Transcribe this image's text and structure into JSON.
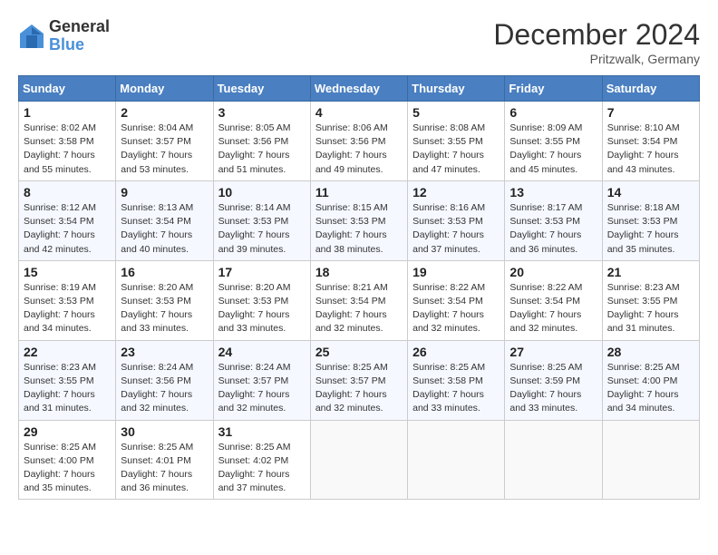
{
  "header": {
    "logo_general": "General",
    "logo_blue": "Blue",
    "month_title": "December 2024",
    "subtitle": "Pritzwalk, Germany"
  },
  "weekdays": [
    "Sunday",
    "Monday",
    "Tuesday",
    "Wednesday",
    "Thursday",
    "Friday",
    "Saturday"
  ],
  "weeks": [
    [
      {
        "day": "1",
        "sunrise": "Sunrise: 8:02 AM",
        "sunset": "Sunset: 3:58 PM",
        "daylight": "Daylight: 7 hours and 55 minutes."
      },
      {
        "day": "2",
        "sunrise": "Sunrise: 8:04 AM",
        "sunset": "Sunset: 3:57 PM",
        "daylight": "Daylight: 7 hours and 53 minutes."
      },
      {
        "day": "3",
        "sunrise": "Sunrise: 8:05 AM",
        "sunset": "Sunset: 3:56 PM",
        "daylight": "Daylight: 7 hours and 51 minutes."
      },
      {
        "day": "4",
        "sunrise": "Sunrise: 8:06 AM",
        "sunset": "Sunset: 3:56 PM",
        "daylight": "Daylight: 7 hours and 49 minutes."
      },
      {
        "day": "5",
        "sunrise": "Sunrise: 8:08 AM",
        "sunset": "Sunset: 3:55 PM",
        "daylight": "Daylight: 7 hours and 47 minutes."
      },
      {
        "day": "6",
        "sunrise": "Sunrise: 8:09 AM",
        "sunset": "Sunset: 3:55 PM",
        "daylight": "Daylight: 7 hours and 45 minutes."
      },
      {
        "day": "7",
        "sunrise": "Sunrise: 8:10 AM",
        "sunset": "Sunset: 3:54 PM",
        "daylight": "Daylight: 7 hours and 43 minutes."
      }
    ],
    [
      {
        "day": "8",
        "sunrise": "Sunrise: 8:12 AM",
        "sunset": "Sunset: 3:54 PM",
        "daylight": "Daylight: 7 hours and 42 minutes."
      },
      {
        "day": "9",
        "sunrise": "Sunrise: 8:13 AM",
        "sunset": "Sunset: 3:54 PM",
        "daylight": "Daylight: 7 hours and 40 minutes."
      },
      {
        "day": "10",
        "sunrise": "Sunrise: 8:14 AM",
        "sunset": "Sunset: 3:53 PM",
        "daylight": "Daylight: 7 hours and 39 minutes."
      },
      {
        "day": "11",
        "sunrise": "Sunrise: 8:15 AM",
        "sunset": "Sunset: 3:53 PM",
        "daylight": "Daylight: 7 hours and 38 minutes."
      },
      {
        "day": "12",
        "sunrise": "Sunrise: 8:16 AM",
        "sunset": "Sunset: 3:53 PM",
        "daylight": "Daylight: 7 hours and 37 minutes."
      },
      {
        "day": "13",
        "sunrise": "Sunrise: 8:17 AM",
        "sunset": "Sunset: 3:53 PM",
        "daylight": "Daylight: 7 hours and 36 minutes."
      },
      {
        "day": "14",
        "sunrise": "Sunrise: 8:18 AM",
        "sunset": "Sunset: 3:53 PM",
        "daylight": "Daylight: 7 hours and 35 minutes."
      }
    ],
    [
      {
        "day": "15",
        "sunrise": "Sunrise: 8:19 AM",
        "sunset": "Sunset: 3:53 PM",
        "daylight": "Daylight: 7 hours and 34 minutes."
      },
      {
        "day": "16",
        "sunrise": "Sunrise: 8:20 AM",
        "sunset": "Sunset: 3:53 PM",
        "daylight": "Daylight: 7 hours and 33 minutes."
      },
      {
        "day": "17",
        "sunrise": "Sunrise: 8:20 AM",
        "sunset": "Sunset: 3:53 PM",
        "daylight": "Daylight: 7 hours and 33 minutes."
      },
      {
        "day": "18",
        "sunrise": "Sunrise: 8:21 AM",
        "sunset": "Sunset: 3:54 PM",
        "daylight": "Daylight: 7 hours and 32 minutes."
      },
      {
        "day": "19",
        "sunrise": "Sunrise: 8:22 AM",
        "sunset": "Sunset: 3:54 PM",
        "daylight": "Daylight: 7 hours and 32 minutes."
      },
      {
        "day": "20",
        "sunrise": "Sunrise: 8:22 AM",
        "sunset": "Sunset: 3:54 PM",
        "daylight": "Daylight: 7 hours and 32 minutes."
      },
      {
        "day": "21",
        "sunrise": "Sunrise: 8:23 AM",
        "sunset": "Sunset: 3:55 PM",
        "daylight": "Daylight: 7 hours and 31 minutes."
      }
    ],
    [
      {
        "day": "22",
        "sunrise": "Sunrise: 8:23 AM",
        "sunset": "Sunset: 3:55 PM",
        "daylight": "Daylight: 7 hours and 31 minutes."
      },
      {
        "day": "23",
        "sunrise": "Sunrise: 8:24 AM",
        "sunset": "Sunset: 3:56 PM",
        "daylight": "Daylight: 7 hours and 32 minutes."
      },
      {
        "day": "24",
        "sunrise": "Sunrise: 8:24 AM",
        "sunset": "Sunset: 3:57 PM",
        "daylight": "Daylight: 7 hours and 32 minutes."
      },
      {
        "day": "25",
        "sunrise": "Sunrise: 8:25 AM",
        "sunset": "Sunset: 3:57 PM",
        "daylight": "Daylight: 7 hours and 32 minutes."
      },
      {
        "day": "26",
        "sunrise": "Sunrise: 8:25 AM",
        "sunset": "Sunset: 3:58 PM",
        "daylight": "Daylight: 7 hours and 33 minutes."
      },
      {
        "day": "27",
        "sunrise": "Sunrise: 8:25 AM",
        "sunset": "Sunset: 3:59 PM",
        "daylight": "Daylight: 7 hours and 33 minutes."
      },
      {
        "day": "28",
        "sunrise": "Sunrise: 8:25 AM",
        "sunset": "Sunset: 4:00 PM",
        "daylight": "Daylight: 7 hours and 34 minutes."
      }
    ],
    [
      {
        "day": "29",
        "sunrise": "Sunrise: 8:25 AM",
        "sunset": "Sunset: 4:00 PM",
        "daylight": "Daylight: 7 hours and 35 minutes."
      },
      {
        "day": "30",
        "sunrise": "Sunrise: 8:25 AM",
        "sunset": "Sunset: 4:01 PM",
        "daylight": "Daylight: 7 hours and 36 minutes."
      },
      {
        "day": "31",
        "sunrise": "Sunrise: 8:25 AM",
        "sunset": "Sunset: 4:02 PM",
        "daylight": "Daylight: 7 hours and 37 minutes."
      },
      null,
      null,
      null,
      null
    ]
  ]
}
